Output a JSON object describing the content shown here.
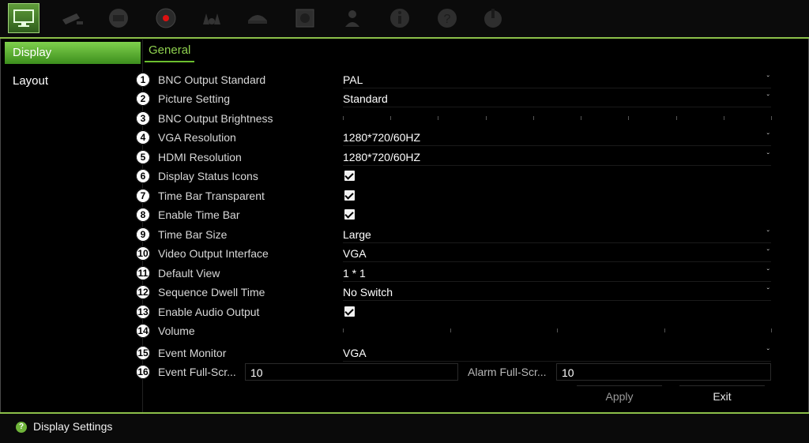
{
  "toolbar": {
    "icons": [
      "display-icon",
      "camera-icon",
      "network-icon",
      "record-icon",
      "alarm-icon",
      "device-icon",
      "storage-icon",
      "user-icon",
      "system-info-icon",
      "help-icon",
      "power-icon"
    ]
  },
  "sidebar": {
    "items": [
      {
        "label": "Display"
      },
      {
        "label": "Layout"
      }
    ]
  },
  "tabs": [
    {
      "label": "General"
    }
  ],
  "settings": [
    {
      "num": "1",
      "label": "BNC Output Standard",
      "value": "PAL"
    },
    {
      "num": "2",
      "label": "Picture Setting",
      "value": "Standard"
    },
    {
      "num": "3",
      "label": "BNC Output Brightness",
      "value": ""
    },
    {
      "num": "4",
      "label": "VGA Resolution",
      "value": "1280*720/60HZ"
    },
    {
      "num": "5",
      "label": "HDMI Resolution",
      "value": "1280*720/60HZ"
    },
    {
      "num": "6",
      "label": "Display Status Icons",
      "checked": true
    },
    {
      "num": "7",
      "label": "Time Bar Transparent",
      "checked": true
    },
    {
      "num": "8",
      "label": "Enable Time Bar",
      "checked": true
    },
    {
      "num": "9",
      "label": "Time Bar Size",
      "value": "Large"
    },
    {
      "num": "10",
      "label": "Video Output Interface",
      "value": "VGA"
    },
    {
      "num": "11",
      "label": "Default View",
      "value": "1 * 1"
    },
    {
      "num": "12",
      "label": "Sequence Dwell Time",
      "value": "No Switch"
    },
    {
      "num": "13",
      "label": "Enable Audio Output",
      "checked": true
    },
    {
      "num": "14",
      "label": "Volume",
      "value": ""
    },
    {
      "num": "15",
      "label": "Event Monitor",
      "value": "VGA"
    },
    {
      "num": "16",
      "label": "Event Full-Scr...",
      "value": "10"
    }
  ],
  "alarm_full_screen": {
    "label": "Alarm Full-Scr...",
    "value": "10"
  },
  "buttons": {
    "apply": "Apply",
    "exit": "Exit"
  },
  "status": {
    "text": "Display Settings",
    "icon": "?"
  }
}
